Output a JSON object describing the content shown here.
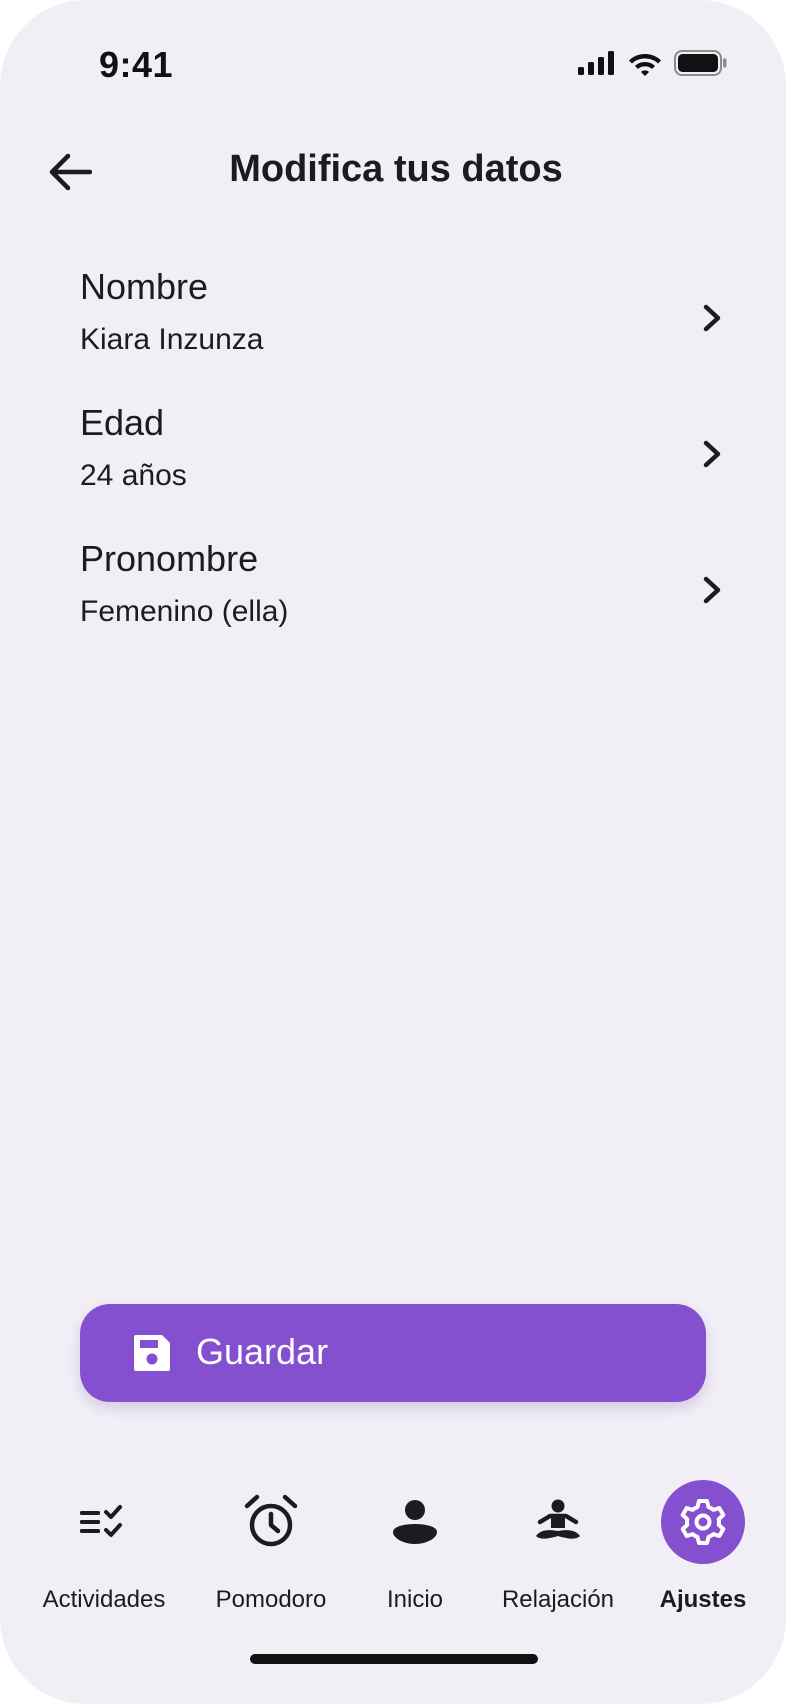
{
  "status_bar": {
    "time": "9:41"
  },
  "header": {
    "title": "Modifica tus datos",
    "back_icon": "arrow-left-icon"
  },
  "fields": [
    {
      "label": "Nombre",
      "value": "Kiara Inzunza",
      "icon": "chevron-right-icon"
    },
    {
      "label": "Edad",
      "value": "24 años",
      "icon": "chevron-right-icon"
    },
    {
      "label": "Pronombre",
      "value": "Femenino (ella)",
      "icon": "chevron-right-icon"
    }
  ],
  "save_button": {
    "label": "Guardar",
    "icon": "save-icon"
  },
  "bottom_nav": {
    "items": [
      {
        "label": "Actividades",
        "icon": "checklist-icon",
        "active": false
      },
      {
        "label": "Pomodoro",
        "icon": "alarm-clock-icon",
        "active": false
      },
      {
        "label": "Inicio",
        "icon": "person-icon",
        "active": false
      },
      {
        "label": "Relajación",
        "icon": "meditation-icon",
        "active": false
      },
      {
        "label": "Ajustes",
        "icon": "gear-icon",
        "active": true
      }
    ]
  },
  "colors": {
    "background": "#f1eef6",
    "accent": "#8450d0",
    "text": "#1d1b20"
  }
}
